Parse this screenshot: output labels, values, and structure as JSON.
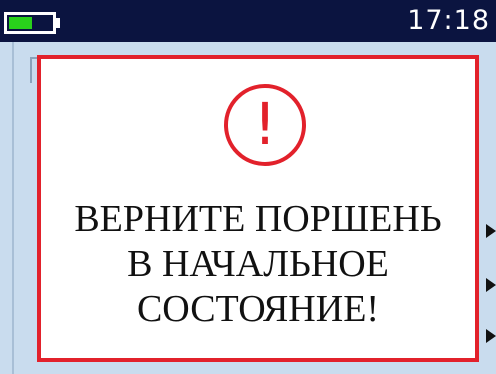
{
  "status_bar": {
    "time": "17:18",
    "battery_level": 0.55,
    "battery_color": "#29d11b",
    "icons": [
      "battery-icon"
    ]
  },
  "dialog": {
    "icon": "exclamation-circle-icon",
    "icon_glyph": "!",
    "message_lines": [
      "ВЕРНИТЕ ПОРШЕНЬ",
      "В НАЧАЛЬНОЕ",
      "СОСТОЯНИЕ!"
    ],
    "border_color": "#e2212b"
  },
  "background": {
    "indicator_icons": [
      "arrow-right-icon",
      "arrow-right-icon",
      "arrow-right-icon"
    ]
  },
  "colors": {
    "status_bar": "#0b1440",
    "screen_background": "#c9dcee",
    "dialog_background": "#ffffff"
  }
}
